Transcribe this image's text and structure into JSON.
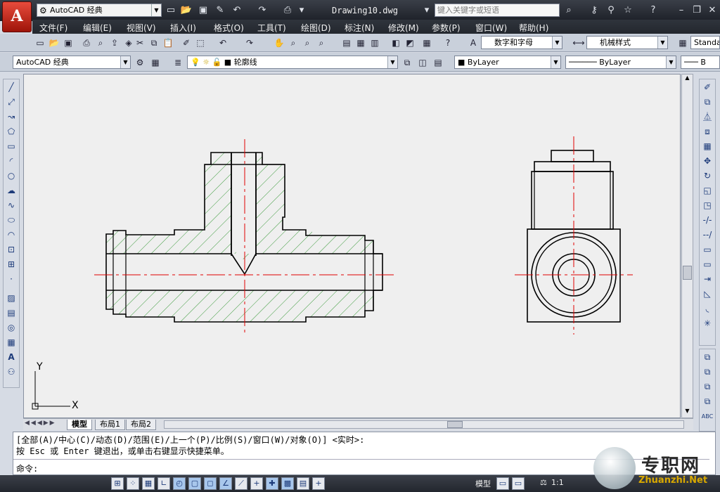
{
  "title_bar": {
    "app_logo": "A",
    "workspace": "AutoCAD 经典",
    "document_title": "Drawing10.dwg",
    "search_placeholder": "键入关键字或短语"
  },
  "menu": [
    "文件(F)",
    "编辑(E)",
    "视图(V)",
    "插入(I)",
    "格式(O)",
    "工具(T)",
    "绘图(D)",
    "标注(N)",
    "修改(M)",
    "参数(P)",
    "窗口(W)",
    "帮助(H)"
  ],
  "styles_toolbar": {
    "text_style": "数字和字母",
    "dim_style": "机械样式",
    "table_style": "Standa"
  },
  "layers_toolbar": {
    "workspace_combo": "AutoCAD 经典",
    "layer": "轮廓线",
    "color": "ByLayer",
    "linetype": "ByLayer",
    "lineweight": "B"
  },
  "canvas": {
    "ucs_x": "X",
    "ucs_y": "Y",
    "tabs": [
      "模型",
      "布局1",
      "布局2"
    ]
  },
  "command": {
    "line1": "[全部(A)/中心(C)/动态(D)/范围(E)/上一个(P)/比例(S)/窗口(W)/对象(O)] <实时>:",
    "line2": "按 Esc 或 Enter 键退出，或单击右键显示快捷菜单。",
    "prompt": "命令:"
  },
  "status_bar": {
    "model_label": "模型",
    "scale": "1:1"
  },
  "watermark": {
    "brand": "专职网",
    "url": "Zhuanzhi.Net"
  },
  "colors": {
    "hatch": "#3a9a3a",
    "centerline": "#e00000",
    "outline": "#000000"
  }
}
